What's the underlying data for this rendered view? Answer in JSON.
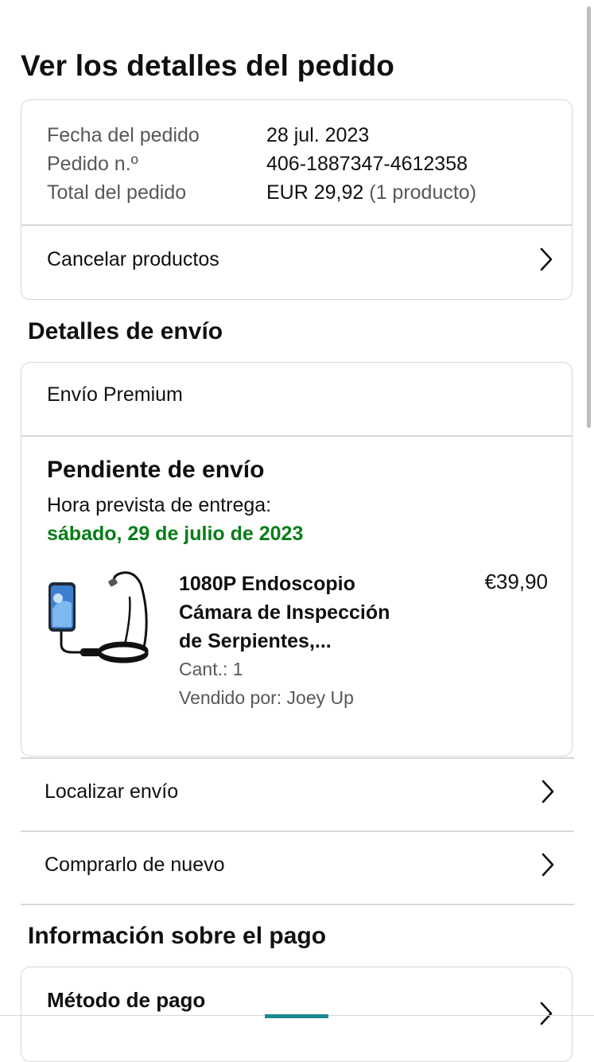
{
  "page": {
    "title": "Ver los detalles del pedido"
  },
  "summary": {
    "rows": [
      {
        "label": "Fecha del pedido",
        "value": "28 jul. 2023"
      },
      {
        "label": "Pedido n.º",
        "value": "406-1887347-4612358"
      },
      {
        "label": "Total del pedido",
        "value": "EUR 29,92",
        "extra": "(1 producto)"
      }
    ],
    "cancel_label": "Cancelar productos"
  },
  "shipping": {
    "heading": "Detalles de envío",
    "type": "Envío Premium",
    "status": "Pendiente de envío",
    "eta_label": "Hora prevista de entrega:",
    "eta_date": "sábado, 29 de julio de 2023",
    "eta_color": "#067d17",
    "product": {
      "title": "1080P Endoscopio Cámara de Inspección de Serpientes,...",
      "price": "€39,90",
      "quantity": "Cant.: 1",
      "seller": "Vendido por: Joey Up",
      "image_icon": "endoscope-camera-product-image"
    }
  },
  "actions": {
    "track_label": "Localizar envío",
    "buy_again_label": "Comprarlo de nuevo"
  },
  "payment": {
    "heading": "Información sobre el pago",
    "method_label": "Método de pago"
  },
  "icons": {
    "chevron": "chevron-right-icon"
  }
}
